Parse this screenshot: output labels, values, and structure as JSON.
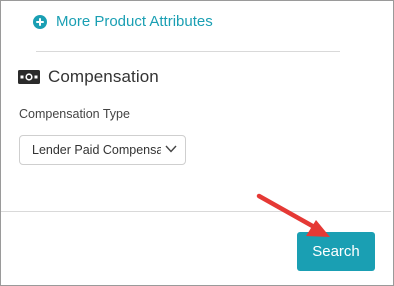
{
  "more_attributes": {
    "label": "More Product Attributes"
  },
  "compensation": {
    "title": "Compensation",
    "field_label": "Compensation Type",
    "selected_value": "Lender Paid Compensa"
  },
  "actions": {
    "search_label": "Search"
  },
  "colors": {
    "accent": "#1a9fb3",
    "annotation": "#e53935"
  },
  "icons": [
    "plus-circle-icon",
    "money-icon",
    "chevron-down-icon",
    "annotation-arrow"
  ]
}
